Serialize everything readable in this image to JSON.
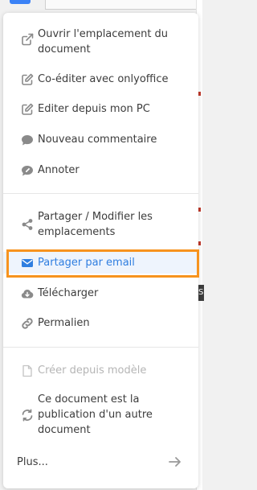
{
  "menu": {
    "items": [
      {
        "label": "Ouvrir l'emplacement du document",
        "icon": "external-link-icon"
      },
      {
        "label": "Co-éditer avec onlyoffice",
        "icon": "edit-icon"
      },
      {
        "label": "Editer depuis mon PC",
        "icon": "edit-icon"
      },
      {
        "label": "Nouveau commentaire",
        "icon": "comment-icon"
      },
      {
        "label": "Annoter",
        "icon": "annotate-icon"
      },
      {
        "label": "Partager / Modifier les emplacements",
        "icon": "share-icon"
      },
      {
        "label": "Partager par email",
        "icon": "envelope-icon"
      },
      {
        "label": "Télécharger",
        "icon": "cloud-download-icon"
      },
      {
        "label": "Permalien",
        "icon": "link-icon"
      },
      {
        "label": "Créer depuis modèle",
        "icon": "file-icon"
      },
      {
        "label": "Ce document est la publication d'un autre document",
        "icon": "sync-icon"
      }
    ],
    "more_label": "Plus...",
    "more_icon": "arrow-right-icon"
  },
  "tooltip_fragment": "S",
  "colors": {
    "accent": "#2f7ee0",
    "text": "#3c3c3c",
    "icon": "#8a8a8a",
    "disabled": "#b5b5b5",
    "active_bg": "#eef4fd",
    "highlight": "#f7931e"
  }
}
